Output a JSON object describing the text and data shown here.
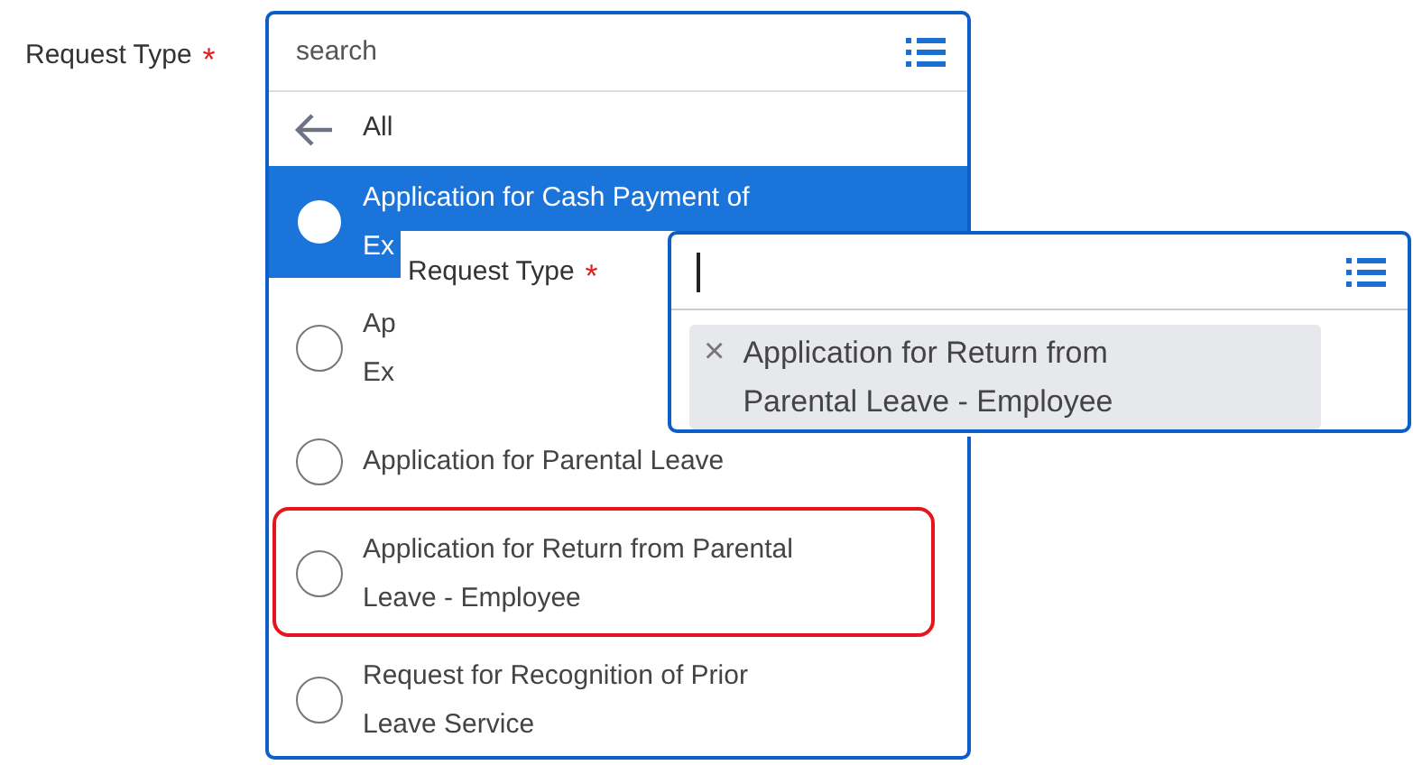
{
  "field": {
    "label": "Request Type",
    "required_mark": "*",
    "search": {
      "placeholder": "search"
    }
  },
  "dropdown": {
    "back_label": "All",
    "options": [
      {
        "lines": [
          "Application for Cash Payment of",
          "Ex"
        ],
        "selected": true,
        "highlighted": false
      },
      {
        "lines": [
          "Ap",
          "Ex"
        ],
        "selected": false,
        "highlighted": false
      },
      {
        "lines": [
          "Application for Parental Leave"
        ],
        "selected": false,
        "highlighted": false
      },
      {
        "lines": [
          "Application for Return from Parental",
          "Leave - Employee"
        ],
        "selected": false,
        "highlighted": true
      },
      {
        "lines": [
          "Request for Recognition of Prior",
          "Leave Service"
        ],
        "selected": false,
        "highlighted": false
      }
    ]
  },
  "overlay_field": {
    "label": "Request Type",
    "required_mark": "*",
    "chips": [
      {
        "remove": "×",
        "lines": [
          "Application for Return from",
          "Parental Leave - Employee"
        ]
      }
    ]
  }
}
